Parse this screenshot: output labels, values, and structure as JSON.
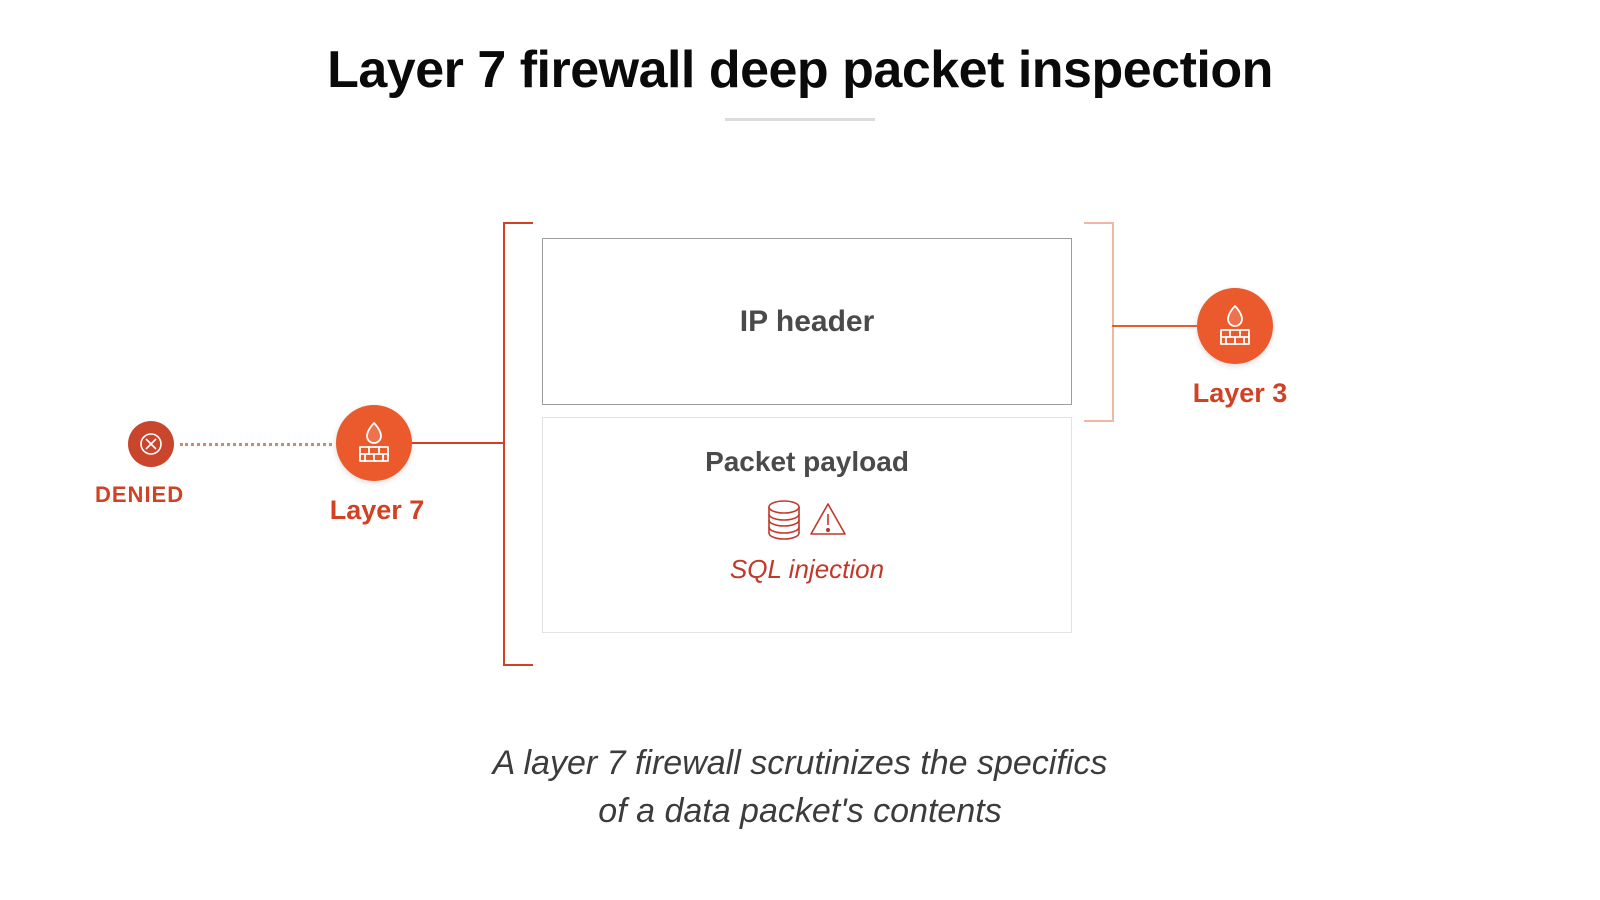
{
  "title": "Layer 7 firewall deep packet inspection",
  "caption_line1": "A layer 7 firewall scrutinizes the specifics",
  "caption_line2": "of a data packet's contents",
  "packet": {
    "ip_header": "IP header",
    "payload_title": "Packet payload",
    "threat_label": "SQL injection"
  },
  "layer7_label": "Layer 7",
  "layer3_label": "Layer 3",
  "denied_label": "DENIED",
  "icons": {
    "firewall": "firewall-icon",
    "denied": "denied-x-icon",
    "database": "database-icon",
    "warning": "warning-triangle-icon"
  },
  "colors": {
    "accent": "#eb5a2d",
    "accent_dark": "#d14124",
    "threat": "#c0392b",
    "box_border": "#9d9d9d",
    "box_border_light": "#e2e2e2"
  }
}
